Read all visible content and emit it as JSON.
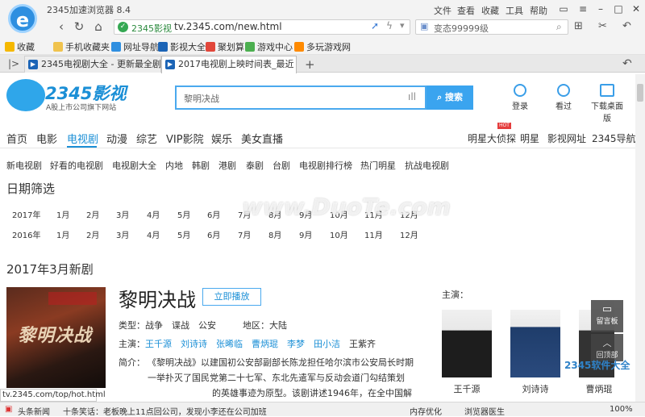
{
  "browser": {
    "title": "2345加速浏览器 8.4",
    "menus": [
      "文件",
      "查看",
      "收藏",
      "工具",
      "帮助"
    ],
    "url": "tv.2345.com/new.html",
    "site_badge": "2345影视",
    "search_placeholder": "变态99999级",
    "bookmarks": [
      "收藏",
      "手机收藏夹",
      "网址导航",
      "影视大全",
      "聚划算",
      "游戏中心",
      "多玩游戏网"
    ],
    "tabs": [
      {
        "label": "2345电视剧大全 - 更新最全剧"
      },
      {
        "label": "2017电视剧上映时间表_最近"
      }
    ]
  },
  "site": {
    "logo": "2345影视",
    "logo_sub": "A股上市公司旗下网站",
    "search_value": "黎明决战",
    "search_btn": "搜索",
    "actions": [
      "登录",
      "看过",
      "下载桌面版"
    ],
    "nav": [
      "首页",
      "电影",
      "电视剧",
      "动漫",
      "综艺",
      "VIP影院",
      "娱乐",
      "美女直播"
    ],
    "nav_right": [
      "明星大侦探",
      "明星",
      "影视网址",
      "2345导航"
    ],
    "hot": "HOT",
    "subnav": [
      "新电视剧",
      "好看的电视剧",
      "电视剧大全",
      "内地",
      "韩剧",
      "港剧",
      "泰剧",
      "台剧",
      "电视剧排行榜",
      "热门明星",
      "抗战电视剧"
    ],
    "date_title": "日期筛选",
    "row2017": [
      "2017年",
      "1月",
      "2月",
      "3月",
      "4月",
      "5月",
      "6月",
      "7月",
      "8月",
      "9月",
      "10月",
      "11月",
      "12月"
    ],
    "row2016": [
      "2016年",
      "1月",
      "2月",
      "3月",
      "4月",
      "5月",
      "6月",
      "7月",
      "8月",
      "9月",
      "10月",
      "11月",
      "12月"
    ],
    "section": "2017年3月新剧",
    "show": {
      "title": "黎明决战",
      "poster_title": "黎明决战",
      "play": "立即播放",
      "type_label": "类型：",
      "types": [
        "战争",
        "谍战",
        "公安"
      ],
      "region_label": "地区：",
      "region": "大陆",
      "cast_label": "主演：",
      "cast": [
        "王千源",
        "刘诗诗",
        "张晞临",
        "曹炳琨",
        "李梦",
        "田小洁",
        "王紫齐"
      ],
      "desc_label": "简介：",
      "desc": [
        "《黎明决战》以建国初公安部副部长陈龙担任哈尔滨市公安局长时期",
        "一举扑灭了国民党第二十七军、东北先遣军与反动会道门勾结策划",
        "的英雄事迹为原型。该剧讲述1946年，在全中国解"
      ]
    },
    "cast_panel_label": "主演：",
    "cast_panel": [
      "王千源",
      "刘诗诗",
      "曹炳琨"
    ],
    "float": [
      "留言板",
      "回顶部"
    ]
  },
  "status": {
    "hover_url": "tv.2345.com/top/hot.html",
    "items": [
      "头条新闻",
      "十条笑话：老板晚上11点回公司，发现小李还在公司加班",
      "内存优化",
      "浏览器医生",
      "100%"
    ]
  },
  "watermark": "www.DuoTe.com",
  "corner_watermark": "2345软件大全"
}
